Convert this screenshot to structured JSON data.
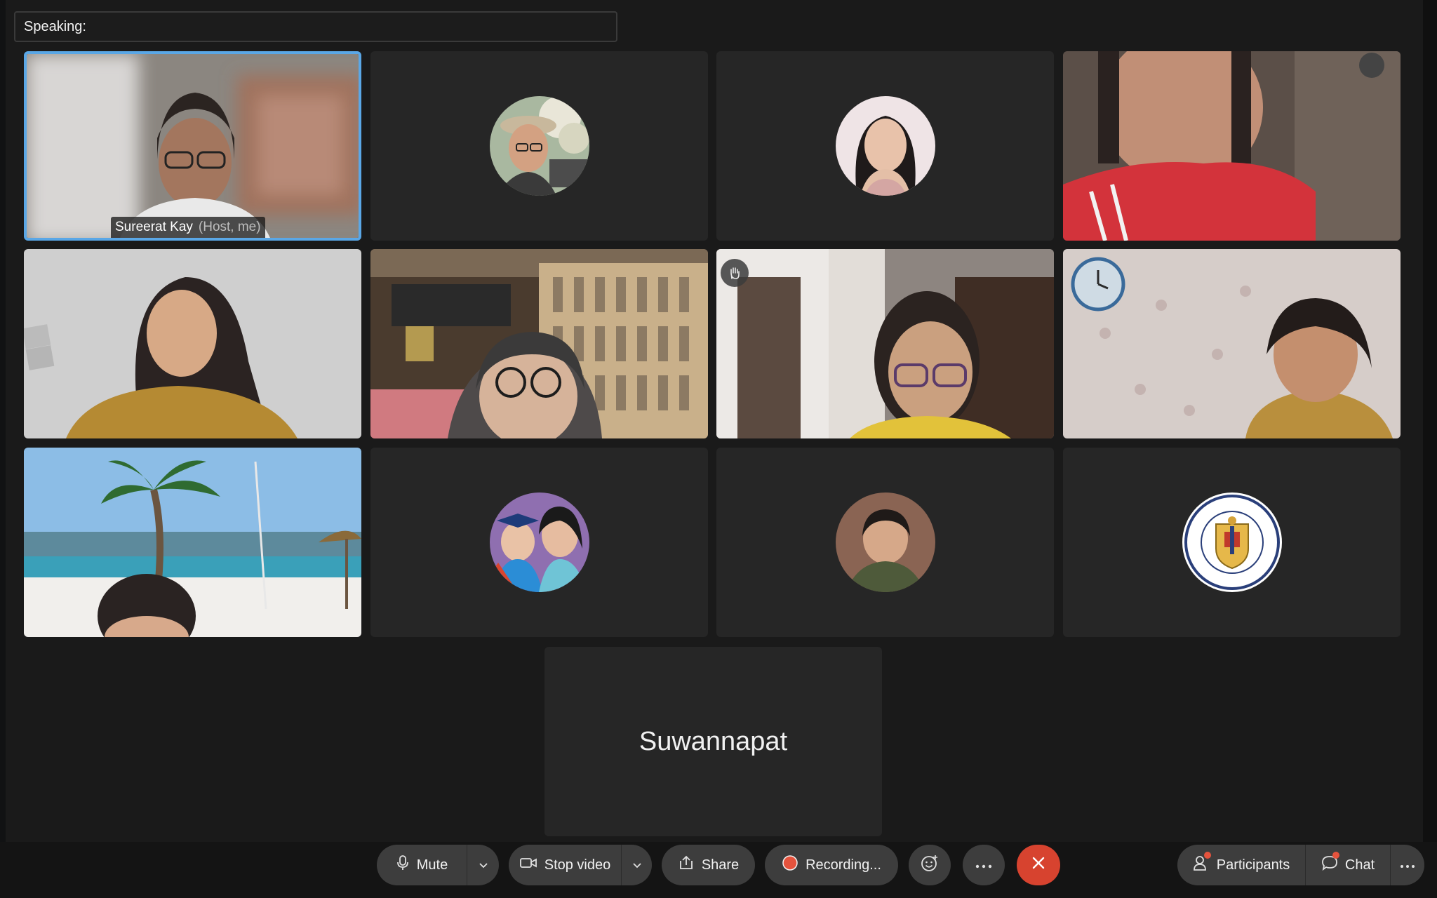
{
  "speaking": {
    "label": "Speaking:"
  },
  "self_tile": {
    "name": "Sureerat Kay",
    "role": "(Host, me)"
  },
  "placeholder_tile": {
    "name": "Suwannapat"
  },
  "toolbar": {
    "mute": "Mute",
    "stop_video": "Stop video",
    "share": "Share",
    "recording": "Recording...",
    "participants": "Participants",
    "chat": "Chat"
  },
  "colors": {
    "active_border": "#5aa7e6",
    "end_button": "#d7432f",
    "record_dot": "#e5533d"
  },
  "icons": [
    "microphone-icon",
    "chevron-down-icon",
    "video-camera-icon",
    "share-icon",
    "record-icon",
    "reaction-icon",
    "more-icon",
    "close-icon",
    "participants-icon",
    "chat-icon",
    "raise-hand-icon"
  ]
}
